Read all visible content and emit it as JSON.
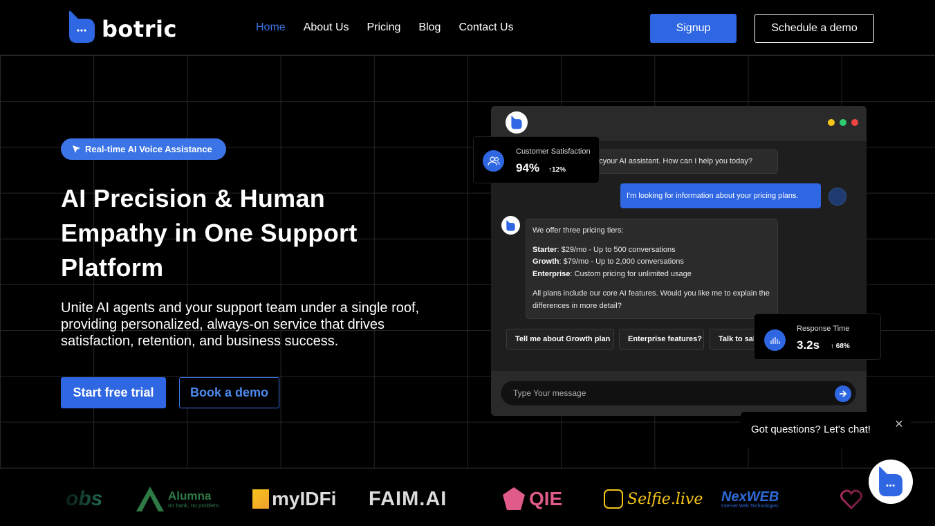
{
  "brand": {
    "name": "botric",
    "accent": "#2f67e3"
  },
  "nav": {
    "items": [
      {
        "label": "Home",
        "active": true
      },
      {
        "label": "About Us",
        "active": false
      },
      {
        "label": "Pricing",
        "active": false
      },
      {
        "label": "Blog",
        "active": false
      },
      {
        "label": "Contact Us",
        "active": false
      }
    ],
    "signup_label": "Signup",
    "schedule_label": "Schedule a demo"
  },
  "hero": {
    "badge": "Real-time AI Voice Assistance",
    "title": "AI Precision & Human Empathy in One Support Platform",
    "subtitle": "Unite AI agents and your support team under a single roof, providing personalized, always-on service that drives satisfaction, retention, and business success.",
    "cta_primary": "Start free trial",
    "cta_secondary": "Book a demo"
  },
  "chat": {
    "window_dots": [
      "#f5c518",
      "#2ecc71",
      "#f04444"
    ],
    "greeting": "I am Botricyour AI assistant. How can I help you today?",
    "user_message": "I'm looking for information about your pricing plans.",
    "reply_intro": "We offer three pricing tiers:",
    "tiers": [
      {
        "name": "Starter",
        "detail": ": $29/mo - Up to 500 conversations"
      },
      {
        "name": "Growth",
        "detail": ": $79/mo - Up to 2,000 conversations"
      },
      {
        "name": "Enterprise",
        "detail": ": Custom pricing for unlimited usage"
      }
    ],
    "reply_outro": "All plans include our core AI features. Would you like me to explain the differences in more detail?",
    "suggestions": [
      "Tell me about Growth plan",
      "Enterprise features?",
      "Talk to sales"
    ],
    "input_placeholder": "Type Your message"
  },
  "stats": {
    "satisfaction": {
      "label": "Customer Satisfaction",
      "value": "94%",
      "delta": "12%"
    },
    "response": {
      "label": "Response Time",
      "value": "3.2s",
      "delta": "68%"
    }
  },
  "popup": {
    "text": "Got questions? Let's chat!"
  },
  "logos": [
    "obs",
    "Alumna",
    "no bank, no problem.",
    "myIDFi",
    "FAIM.AI",
    "QIE",
    "Selfie.live",
    "NexWEB",
    "Internet Web Technologies"
  ]
}
